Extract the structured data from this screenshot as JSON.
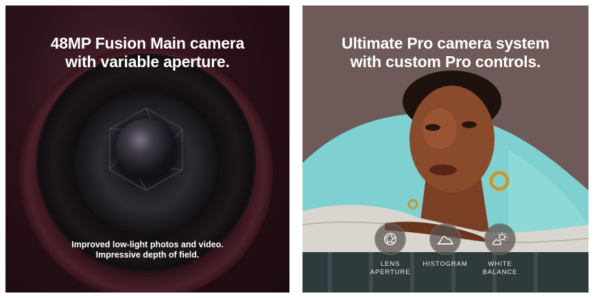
{
  "cards": [
    {
      "headline": [
        "48MP Fusion Main camera",
        "with variable aperture."
      ],
      "caption": [
        "Improved low-light photos and video.",
        "Impressive depth of field."
      ]
    },
    {
      "headline": [
        "Ultimate Pro camera system",
        "with custom Pro controls."
      ],
      "controls": [
        {
          "label": "LENS\nAPERTURE",
          "icon": "aperture-icon"
        },
        {
          "label": "HISTOGRAM",
          "icon": "histogram-icon"
        },
        {
          "label": "WHITE\nBALANCE",
          "icon": "sun-cloud-icon"
        }
      ]
    }
  ],
  "colors": {
    "left_background": "#2a1117",
    "right_background": "#6e5a59",
    "sky": "#7fd0d0",
    "text": "#ffffff"
  }
}
